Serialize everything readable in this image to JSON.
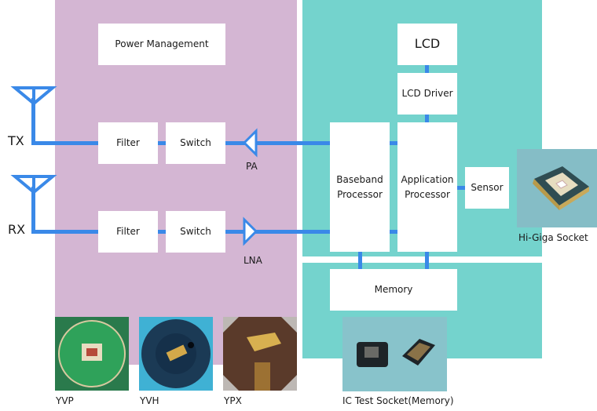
{
  "colors": {
    "rf_section": "#d4b6d3",
    "digital_section": "#74d3cd",
    "signal_line": "#3a89e8",
    "block": "#ffffff"
  },
  "rf": {
    "power_management": "Power Management",
    "tx": {
      "label": "TX",
      "filter": "Filter",
      "switch": "Switch",
      "amp": "PA"
    },
    "rx": {
      "label": "RX",
      "filter": "Filter",
      "switch": "Switch",
      "amp": "LNA"
    }
  },
  "digital": {
    "lcd": "LCD",
    "lcd_driver": "LCD Driver",
    "baseband": [
      "Baseband",
      "Processor"
    ],
    "application": [
      "Application",
      "Processor"
    ],
    "sensor": "Sensor",
    "memory": "Memory"
  },
  "products": {
    "hi_giga": "Hi-Giga Socket",
    "ic_test": "IC Test Socket(Memory)",
    "yvp": "YVP",
    "yvh": "YVH",
    "ypx": "YPX"
  }
}
